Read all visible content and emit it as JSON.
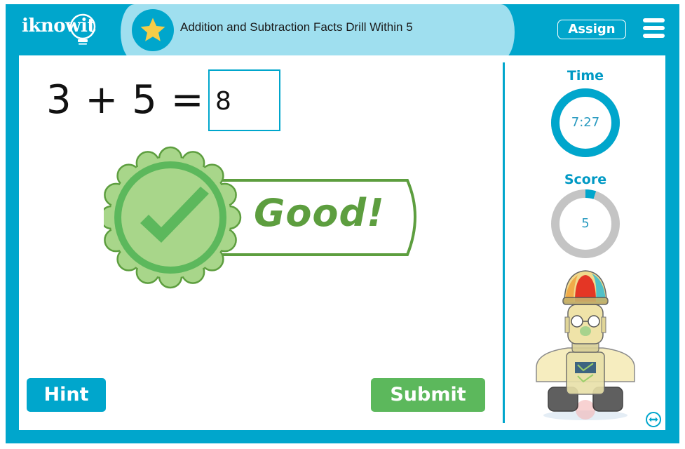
{
  "header": {
    "logo_text": "iknowit",
    "title": "Addition and Subtraction Facts Drill Within 5",
    "title_icon": "star-icon",
    "assign_label": "Assign",
    "menu_icon": "hamburger-menu-icon"
  },
  "question": {
    "equation": "3 + 5 =",
    "answer_value": "8"
  },
  "feedback": {
    "icon": "checkmark-badge-icon",
    "message": "Good!"
  },
  "buttons": {
    "hint_label": "Hint",
    "submit_label": "Submit"
  },
  "sidebar": {
    "time_label": "Time",
    "time_value": "7:27",
    "time_progress": 1.0,
    "score_label": "Score",
    "score_value": "5",
    "score_progress": 0.05,
    "character": "robot-character",
    "swap_icon": "swap-horizontal-icon"
  },
  "colors": {
    "brand_blue": "#00a6cc",
    "pill_light_blue": "#9fdfef",
    "success_green": "#5cb85c",
    "badge_green": "#5d9e3f",
    "ring_gray": "#c4c4c4",
    "star_yellow": "#f5cd47"
  }
}
